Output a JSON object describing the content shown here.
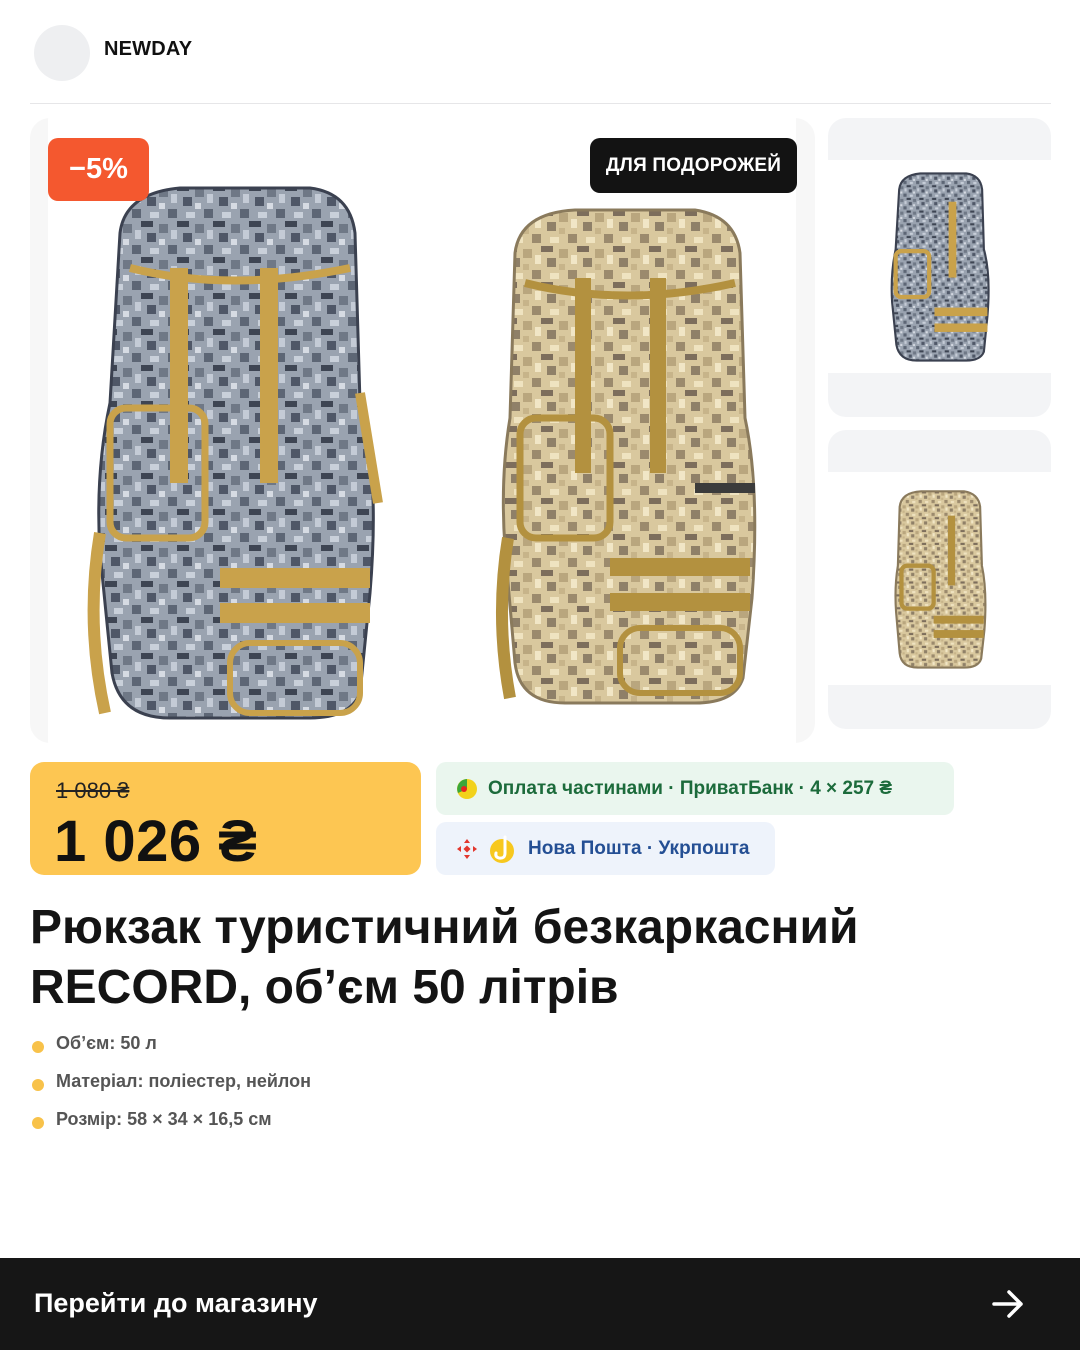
{
  "store": {
    "name": "NEWDAY"
  },
  "badges": {
    "discount": "−5%",
    "tag": "ДЛЯ ПОДОРОЖЕЙ"
  },
  "gallery": {
    "main_colors": [
      "gray digital camo",
      "sand digital camo"
    ],
    "thumbnails": [
      "gray digital camo",
      "sand digital camo"
    ]
  },
  "price": {
    "old": "1 080 ₴",
    "current": "1 026 ₴"
  },
  "payment": {
    "text": "Оплата частинами · ПриватБанк · 4 × 257 ₴",
    "icon": "privatbank-icon"
  },
  "shipping": {
    "text": "Нова Пошта · Укрпошта",
    "icons": [
      "nova-poshta-icon",
      "ukrposhta-icon"
    ]
  },
  "product": {
    "title": "Рюкзак туристичний безкаркасний RECORD, обʼєм 50 літрів",
    "specs": [
      "Обʼєм: 50 л",
      "Матеріал: поліестер, нейлон",
      "Розмір: 58 × 34 × 16,5 см"
    ]
  },
  "cta": {
    "label": "Перейти до магазину",
    "icon": "arrow-right-icon"
  },
  "colors": {
    "accent_yellow": "#FDC652",
    "discount_red": "#F4582F",
    "pay_green": "#1C6B3B",
    "ship_blue": "#244F94",
    "cta_black": "#161616"
  }
}
